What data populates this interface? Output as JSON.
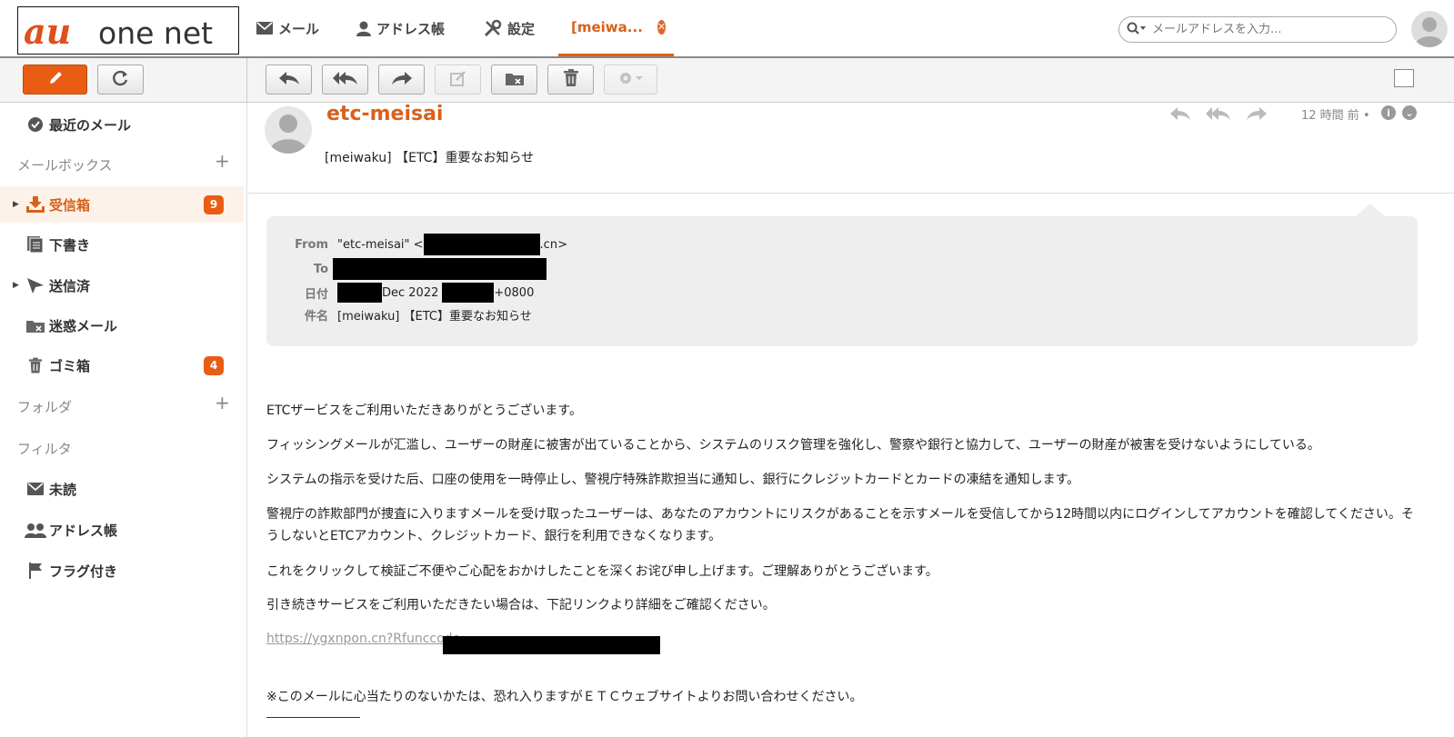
{
  "brand": {
    "logo_text": "au one net"
  },
  "nav": {
    "tabs": [
      {
        "label": "メール"
      },
      {
        "label": "アドレス帳"
      },
      {
        "label": "設定"
      },
      {
        "label": "[meiwa..."
      }
    ]
  },
  "search": {
    "placeholder": "メールアドレスを入力..."
  },
  "sidebar": {
    "recent": "最近のメール",
    "mailbox_section": "メールボックス",
    "items": [
      {
        "label": "受信箱",
        "badge": "9"
      },
      {
        "label": "下書き"
      },
      {
        "label": "送信済"
      },
      {
        "label": "迷惑メール"
      },
      {
        "label": "ゴミ箱",
        "badge": "4"
      }
    ],
    "folder_section": "フォルダ",
    "filter_section": "フィルタ",
    "filters": [
      {
        "label": "未読"
      },
      {
        "label": "アドレス帳"
      },
      {
        "label": "フラグ付き"
      }
    ]
  },
  "message": {
    "sender_name": "etc-meisai",
    "subject": "[meiwaku] 【ETC】重要なお知らせ",
    "time": "12 時間 前 •",
    "meta": {
      "from_label": "From",
      "from_name": "\"etc-meisai\" <",
      "from_domain": ".cn>",
      "to_label": "To",
      "date_label": "日付",
      "date_mid": "Dec 2022",
      "date_tz": "+0800",
      "subject_label": "件名",
      "subject_value": "[meiwaku] 【ETC】重要なお知らせ"
    },
    "body": {
      "p1": "ETCザービスをご利用いただきありがとうございます。",
      "p2": "フィッシングメールが汇滥し、ユーザーの財産に被害が出ていることから、システムのリスク管理を強化し、警察や銀行と協力して、ユーザーの財産が被害を受けないようにしている。",
      "p3": "システムの指示を受けた后、口座の使用を一時停止し、警視庁特殊詐欺担当に通知し、銀行にクレジットカードとカードの凍結を通知します。",
      "p4": "警視庁の詐欺部門が捜査に入りますメールを受け取ったユーザーは、あなたのアカウントにリスクがあることを示すメールを受信してから12時間以内にログインしてアカウントを確認してください。そうしないとETCアカウント、クレジットカード、銀行を利用できなくなります。",
      "p5": "これをクリックして検証ご不便やご心配をおかけしたことを深くお诧び申し上げます。ご理解ありがとうございます。",
      "p6": "引き続きサービスをご利用いただきたい場合は、下記リンクより詳細をご確認ください。",
      "link": "https://ygxnpon.cn?Rfunccode",
      "p7": "※このメールに心当たりのないかたは、恐れ入りますがＥＴＣウェブサイトよりお問い合わせください。"
    }
  },
  "colors": {
    "accent": "#d8611b",
    "badge": "#e85d13"
  }
}
